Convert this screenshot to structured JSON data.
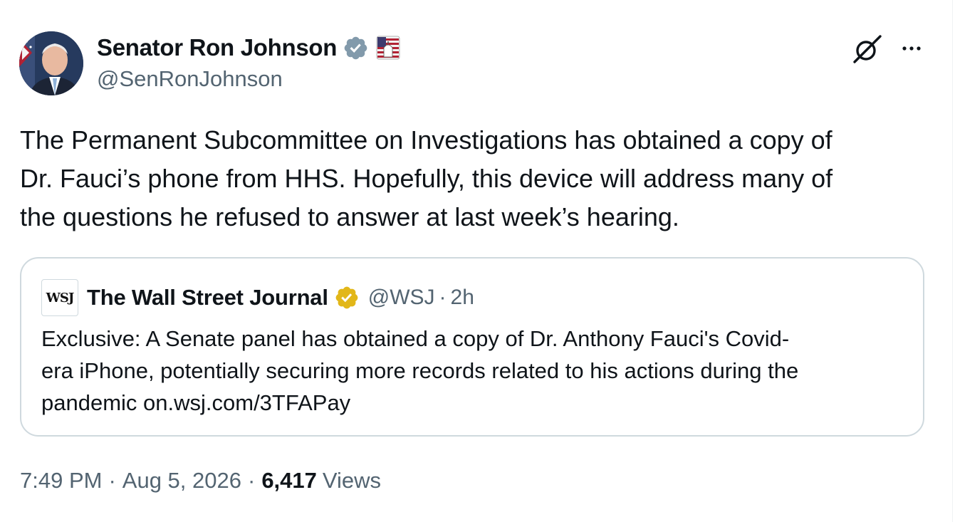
{
  "author": {
    "name": "Senator Ron Johnson",
    "handle": "@SenRonJohnson",
    "verified_icon": "verified-badge-icon",
    "affiliation_icon": "government-capitol-flag-icon"
  },
  "tweet": {
    "text": "The Permanent Subcommittee on Investigations has obtained a copy of\nDr. Fauci’s phone from HHS. Hopefully, this device will address many of\nthe questions he refused to answer at last week’s hearing."
  },
  "header_actions": {
    "grok_icon": "grok-icon",
    "more_icon": "more-options-icon"
  },
  "quote": {
    "logo_text": "WSJ",
    "name": "The Wall Street Journal",
    "handle": "@WSJ",
    "separator": "·",
    "time": "2h",
    "text": "Exclusive: A Senate panel has obtained a copy of Dr. Anthony Fauci's Covid-\nera iPhone, potentially securing more records related to his actions during the\npandemic on.wsj.com/3TFAPay"
  },
  "meta": {
    "time": "7:49 PM",
    "sep1": "·",
    "date": "Aug 5, 2026",
    "sep2": "·",
    "views_count": "6,417",
    "views_label": "Views"
  },
  "colors": {
    "verified_blue": "#1d9bf0",
    "verified_grey": "#829aab",
    "gold_badge": "#e2b719",
    "secondary_text": "#536471",
    "border": "#cfd9de"
  }
}
